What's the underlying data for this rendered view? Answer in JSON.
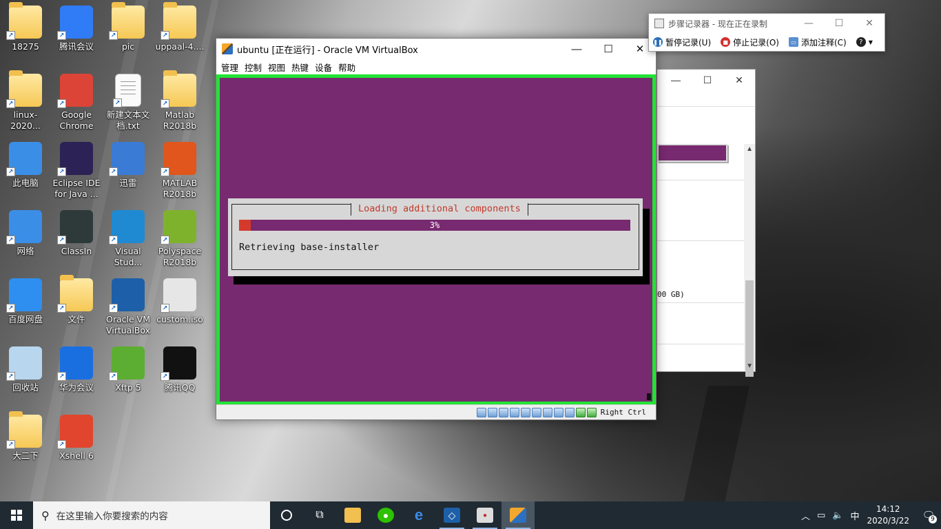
{
  "desktop": {
    "icons": [
      {
        "label": "18275",
        "icon": "user-folder-icon",
        "color": "#f6c855"
      },
      {
        "label": "腾讯会议",
        "icon": "tencent-meeting-icon",
        "color": "#2f7cf6"
      },
      {
        "label": "pic",
        "icon": "folder-icon",
        "color": "#f6c855"
      },
      {
        "label": "uppaal-4....",
        "icon": "folder-icon",
        "color": "#f6c855"
      },
      {
        "label": "linux-2020...",
        "icon": "folder-icon",
        "color": "#f6c855"
      },
      {
        "label": "Google Chrome",
        "icon": "chrome-icon",
        "color": "#db4437"
      },
      {
        "label": "新建文本文档.txt",
        "icon": "text-file-icon",
        "color": "#fafafa"
      },
      {
        "label": "Matlab R2018b",
        "icon": "folder-icon",
        "color": "#f6c855"
      },
      {
        "label": "此电脑",
        "icon": "computer-icon",
        "color": "#3a8ee6"
      },
      {
        "label": "Eclipse IDE for Java ...",
        "icon": "eclipse-icon",
        "color": "#2c2255"
      },
      {
        "label": "迅雷",
        "icon": "xunlei-icon",
        "color": "#3a7bd5"
      },
      {
        "label": "MATLAB R2018b",
        "icon": "matlab-icon",
        "color": "#e0561c"
      },
      {
        "label": "网络",
        "icon": "network-icon",
        "color": "#3a8ee6"
      },
      {
        "label": "ClassIn",
        "icon": "classin-icon",
        "color": "#2e3a3a"
      },
      {
        "label": "Visual Stud...",
        "icon": "vscode-icon",
        "color": "#1f8ad2"
      },
      {
        "label": "Polyspace R2018b",
        "icon": "polyspace-icon",
        "color": "#7fb22c"
      },
      {
        "label": "百度网盘",
        "icon": "baidu-netdisk-icon",
        "color": "#2f8ff0"
      },
      {
        "label": "文件",
        "icon": "folder-icon",
        "color": "#f6c855"
      },
      {
        "label": "Oracle VM VirtualBox",
        "icon": "virtualbox-icon",
        "color": "#1d5fa8"
      },
      {
        "label": "custom.iso",
        "icon": "iso-file-icon",
        "color": "#e6e6e6"
      },
      {
        "label": "回收站",
        "icon": "recycle-bin-icon",
        "color": "#b8d6ee"
      },
      {
        "label": "华为会议",
        "icon": "huawei-meeting-icon",
        "color": "#1a6fe0"
      },
      {
        "label": "Xftp 5",
        "icon": "xftp-icon",
        "color": "#5cae32"
      },
      {
        "label": "腾讯QQ",
        "icon": "qq-icon",
        "color": "#111111"
      },
      {
        "label": "大二下",
        "icon": "folder-icon",
        "color": "#f6c855"
      },
      {
        "label": "Xshell 6",
        "icon": "xshell-icon",
        "color": "#e2452d"
      }
    ]
  },
  "vbox": {
    "title": "ubuntu [正在运行] - Oracle VM VirtualBox",
    "minimize": "—",
    "maximize": "☐",
    "close": "✕",
    "menu": [
      "管理",
      "控制",
      "视图",
      "热键",
      "设备",
      "帮助"
    ],
    "host_key": "Right Ctrl",
    "accent_border": "#21e335",
    "screen_color": "#772a6f"
  },
  "installer": {
    "title": "Loading additional components",
    "progress_percent": 3,
    "progress_text": "3%",
    "status": "Retrieving base-installer"
  },
  "second_window": {
    "minimize": "—",
    "maximize": "☐",
    "close": "✕",
    "disk_text": "00 GB)"
  },
  "steps_recorder": {
    "title": "步骤记录器 - 现在正在录制",
    "minimize": "—",
    "maximize": "☐",
    "close": "✕",
    "pause": "暂停记录(U)",
    "stop": "停止记录(O)",
    "comment": "添加注释(C)",
    "help": "?"
  },
  "taskbar": {
    "search_placeholder": "在这里输入你要搜索的内容",
    "time": "14:12",
    "date": "2020/3/22",
    "ime": "中",
    "notifications": "9"
  }
}
